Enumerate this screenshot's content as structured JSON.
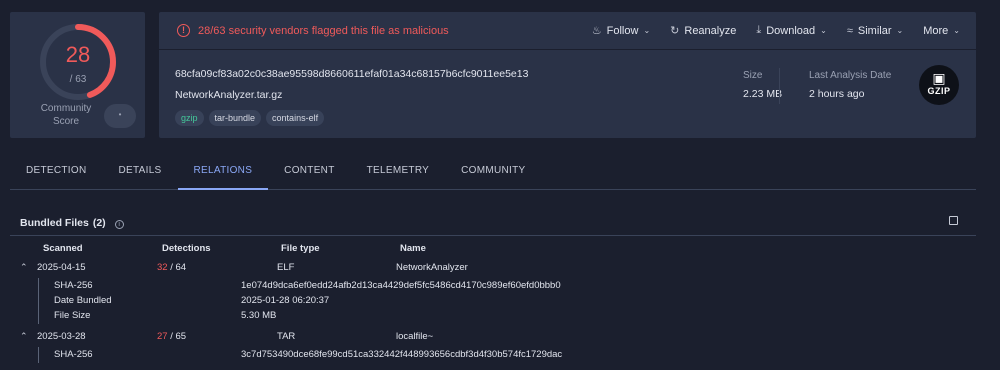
{
  "score": {
    "detected": 28,
    "total_label": "/ 63",
    "fraction": 0.444,
    "community_label_1": "Community",
    "community_label_2": "Score"
  },
  "alert": {
    "text": "28/63 security vendors flagged this file as malicious"
  },
  "actions": [
    {
      "label": "Follow",
      "icon": "bell-icon"
    },
    {
      "label": "Reanalyze",
      "icon": "refresh-icon"
    },
    {
      "label": "Download",
      "icon": "download-icon"
    },
    {
      "label": "Similar",
      "icon": "similar-icon"
    },
    {
      "label": "More",
      "icon": "chevron-down-icon"
    }
  ],
  "file": {
    "hash": "68cfa09cf83a02c0c38ae95598d8660611efaf01a34c68157b6cfc9011ee5e13",
    "name": "NetworkAnalyzer.tar.gz",
    "tags": [
      "gzip",
      "tar-bundle",
      "contains-elf"
    ],
    "size_label": "Size",
    "size": "2.23 MB",
    "last_label": "Last Analysis Date",
    "last": "2 hours ago",
    "type_logo": "GZIP"
  },
  "tabs": [
    "DETECTION",
    "DETAILS",
    "RELATIONS",
    "CONTENT",
    "TELEMETRY",
    "COMMUNITY"
  ],
  "active_tab": "RELATIONS",
  "bundled": {
    "title": "Bundled Files",
    "count": "(2)",
    "headers": {
      "scanned": "Scanned",
      "detections": "Detections",
      "filetype": "File type",
      "name": "Name"
    },
    "rows": [
      {
        "scanned": "2025-04-15",
        "det": "32",
        "total": "/ 64",
        "type": "ELF",
        "name": "NetworkAnalyzer",
        "details": [
          {
            "k": "SHA-256",
            "v": "1e074d9dca6ef0edd24afb2d13ca4429def5fc5486cd4170c989ef60efd0bbb0"
          },
          {
            "k": "Date Bundled",
            "v": "2025-01-28 06:20:37"
          },
          {
            "k": "File Size",
            "v": "5.30 MB"
          }
        ]
      },
      {
        "scanned": "2025-03-28",
        "det": "27",
        "total": "/ 65",
        "type": "TAR",
        "name": "localfile~",
        "details": [
          {
            "k": "SHA-256",
            "v": "3c7d753490dce68fe99cd51ca332442f448993656cdbf3d4f30b574fc1729dac"
          }
        ]
      }
    ]
  },
  "colors": {
    "danger": "#f05a5a",
    "accent": "#8aa7f5",
    "panel": "#2a3247",
    "bg": "#1b1f2e",
    "tag_green": "#44c79a"
  }
}
